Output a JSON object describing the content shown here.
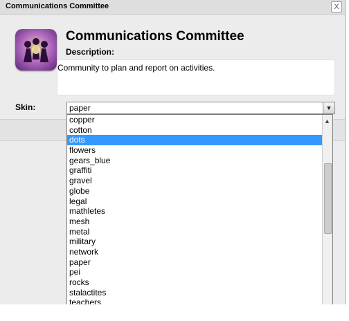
{
  "window": {
    "title": "Communications Committee",
    "close_label": "X"
  },
  "header": {
    "group_name": "Communications Committee",
    "description_label": "Description:",
    "description_text": "Community to plan and report on activities.",
    "avatar_icon": "group-people-icon"
  },
  "skin": {
    "label": "Skin:",
    "selected": "paper",
    "highlighted": "dots",
    "options": [
      "copper",
      "cotton",
      "dots",
      "flowers",
      "gears_blue",
      "graffiti",
      "gravel",
      "globe",
      "legal",
      "mathletes",
      "mesh",
      "metal",
      "military",
      "network",
      "paper",
      "pei",
      "rocks",
      "stalactites",
      "teachers"
    ]
  },
  "colors": {
    "highlight": "#3399ff",
    "panel": "#ececec"
  }
}
